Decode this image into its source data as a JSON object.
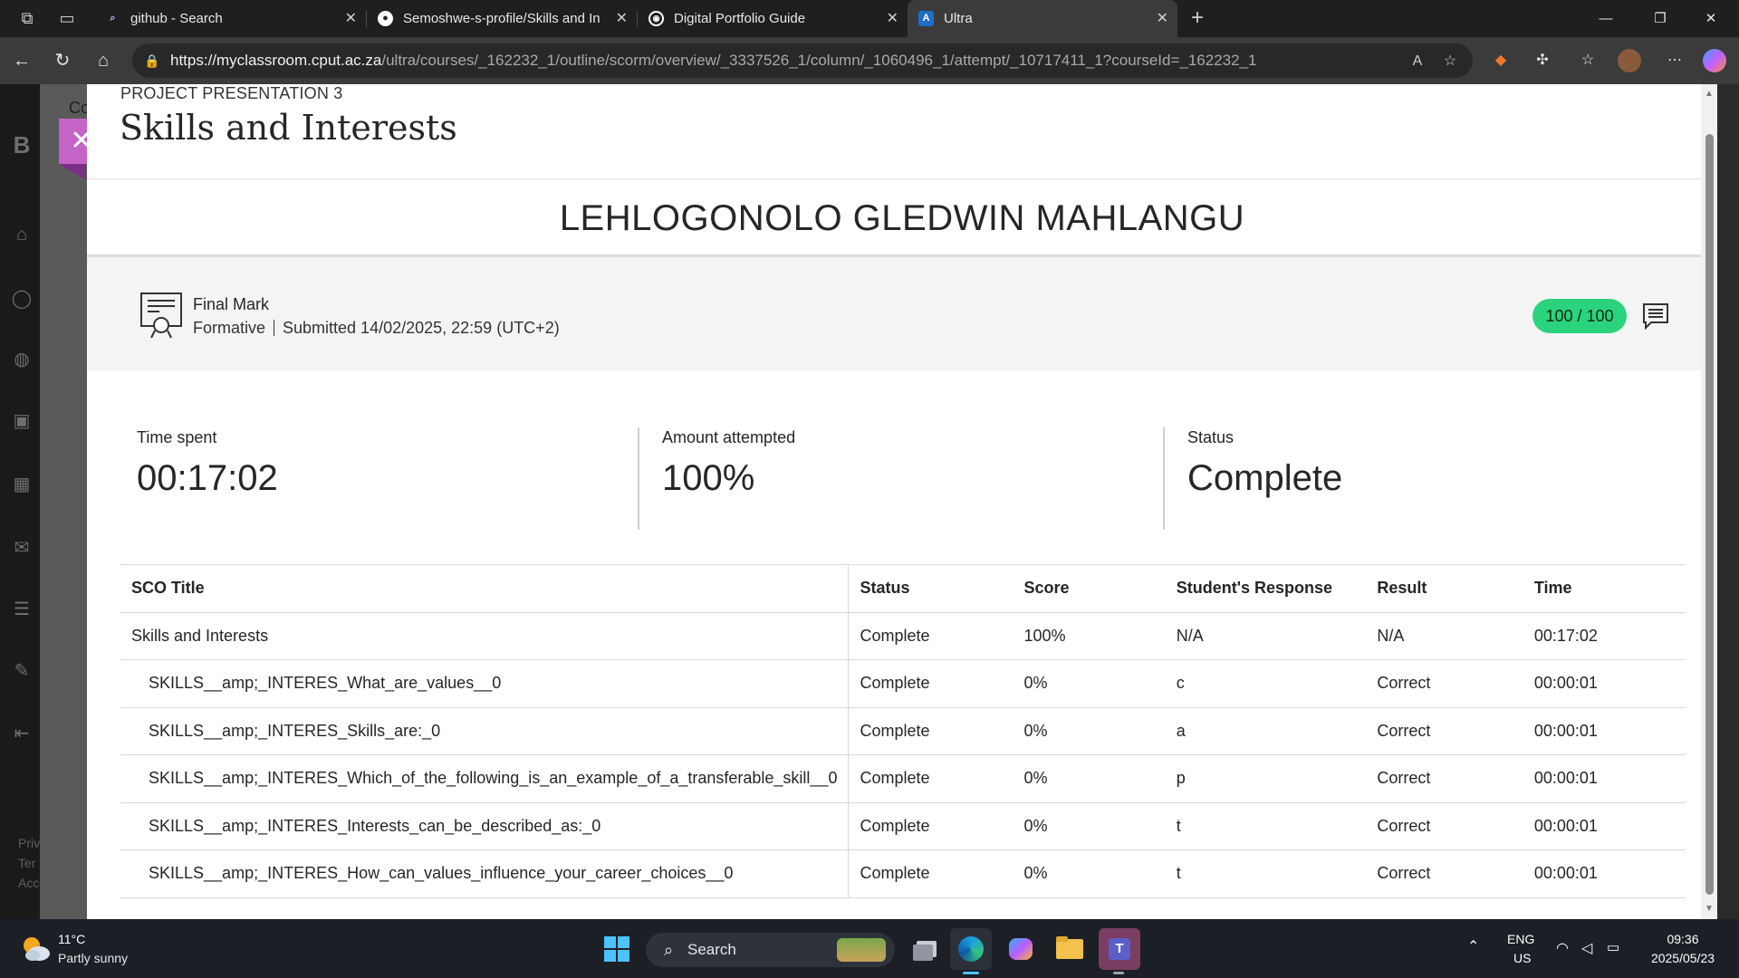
{
  "browser": {
    "tabs": [
      {
        "title": "github - Search",
        "icon": "search-icon"
      },
      {
        "title": "Semoshwe-s-profile/Skills and Int",
        "icon": "github-icon"
      },
      {
        "title": "Digital Portfolio Guide",
        "icon": "globe-icon"
      },
      {
        "title": "Ultra",
        "icon": "ultra-icon",
        "active": true
      }
    ],
    "url_host": "https://myclassroom.cput.ac.za",
    "url_path": "/ultra/courses/_162232_1/outline/scorm/overview/_3337526_1/column/_1060496_1/attempt/_10717411_1?courseId=_162232_1"
  },
  "background_page": {
    "initial": "B",
    "course_fragment": "Co",
    "footer": [
      "Priv",
      "Ter",
      "Acc"
    ]
  },
  "modal": {
    "subtitle": "PROJECT PRESENTATION 3",
    "title": "Skills and Interests",
    "student_name": "LEHLOGONOLO GLEDWIN MAHLANGU",
    "final_mark": {
      "label": "Final Mark",
      "type": "Formative",
      "submitted": "Submitted 14/02/2025, 22:59 (UTC+2)",
      "grade": "100 / 100"
    },
    "stats": [
      {
        "label": "Time spent",
        "value": "00:17:02"
      },
      {
        "label": "Amount attempted",
        "value": "100%"
      },
      {
        "label": "Status",
        "value": "Complete"
      }
    ],
    "table": {
      "headers": [
        "SCO Title",
        "Status",
        "Score",
        "Student's Response",
        "Result",
        "Time"
      ],
      "rows": [
        [
          "Skills and Interests",
          "Complete",
          "100%",
          "N/A",
          "N/A",
          "00:17:02"
        ],
        [
          "SKILLS__amp;_INTERES_What_are_values__0",
          "Complete",
          "0%",
          "c",
          "Correct",
          "00:00:01"
        ],
        [
          "SKILLS__amp;_INTERES_Skills_are:_0",
          "Complete",
          "0%",
          "a",
          "Correct",
          "00:00:01"
        ],
        [
          "SKILLS__amp;_INTERES_Which_of_the_following_is_an_example_of_a_transferable_skill__0",
          "Complete",
          "0%",
          "p",
          "Correct",
          "00:00:01"
        ],
        [
          "SKILLS__amp;_INTERES_Interests_can_be_described_as:_0",
          "Complete",
          "0%",
          "t",
          "Correct",
          "00:00:01"
        ],
        [
          "SKILLS__amp;_INTERES_How_can_values_influence_your_career_choices__0",
          "Complete",
          "0%",
          "t",
          "Correct",
          "00:00:01"
        ]
      ]
    }
  },
  "taskbar": {
    "weather_temp": "11°C",
    "weather_desc": "Partly sunny",
    "search_label": "Search",
    "lang": "ENG",
    "region": "US",
    "time": "09:36",
    "date": "2025/05/23"
  },
  "colors": {
    "accent_close": "#c564c7",
    "grade_pill": "#2bd37c"
  }
}
